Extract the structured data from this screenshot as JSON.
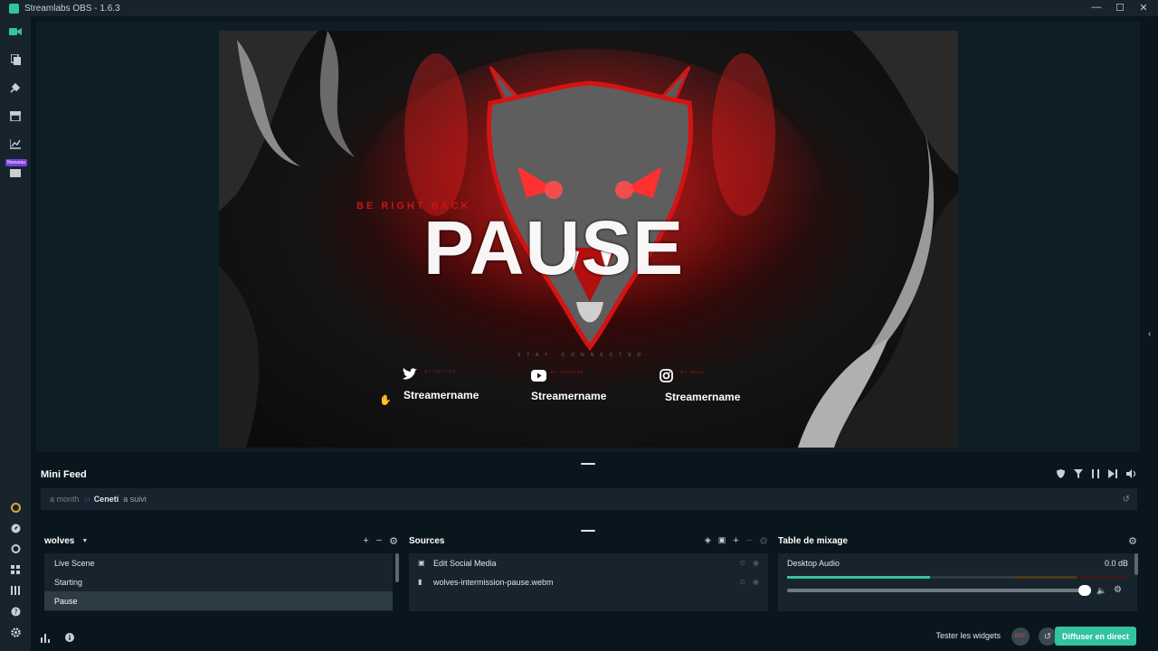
{
  "window": {
    "title": "Streamlabs OBS - 1.6.3",
    "controls": [
      "—",
      "☐",
      "✕"
    ]
  },
  "sidebar": {
    "new_badge": "Nouveau"
  },
  "canvas": {
    "brb_text": "BE RIGHT BACK",
    "headline": "PAUSE",
    "stay_connected": "STAY CONNECTED",
    "socials": [
      {
        "tag": "MY TWITTER",
        "name": "Streamername",
        "icon": "twitter-icon"
      },
      {
        "tag": "MY YOUTUBE",
        "name": "Streamername",
        "icon": "youtube-icon"
      },
      {
        "tag": "MY INSTA...",
        "name": "Streamername",
        "icon": "instagram-icon"
      }
    ]
  },
  "minifeed": {
    "title": "Mini Feed",
    "event": {
      "time": "a month",
      "user": "Ceneti",
      "action": "a suivi"
    }
  },
  "scenes": {
    "collection": "wolves",
    "items": [
      {
        "label": "Live Scene",
        "active": false
      },
      {
        "label": "Starting",
        "active": false
      },
      {
        "label": "Pause",
        "active": true
      }
    ]
  },
  "sources": {
    "title": "Sources",
    "items": [
      {
        "label": "Edit Social Media",
        "icon": "group-icon"
      },
      {
        "label": "wolves-intermission-pause.webm",
        "icon": "file-icon"
      }
    ]
  },
  "mixer": {
    "title": "Table de mixage",
    "channel": {
      "name": "Desktop Audio",
      "db": "0.0 dB",
      "level": 0.42,
      "volume": 0.98
    }
  },
  "footer": {
    "test_widgets": "Tester les widgets",
    "rec": "REC",
    "go_live": "Diffuser en direct"
  },
  "colors": {
    "accent": "#31c3a2",
    "bg": "#09161d",
    "panel": "#17242d",
    "brand_red": "#e01818"
  }
}
